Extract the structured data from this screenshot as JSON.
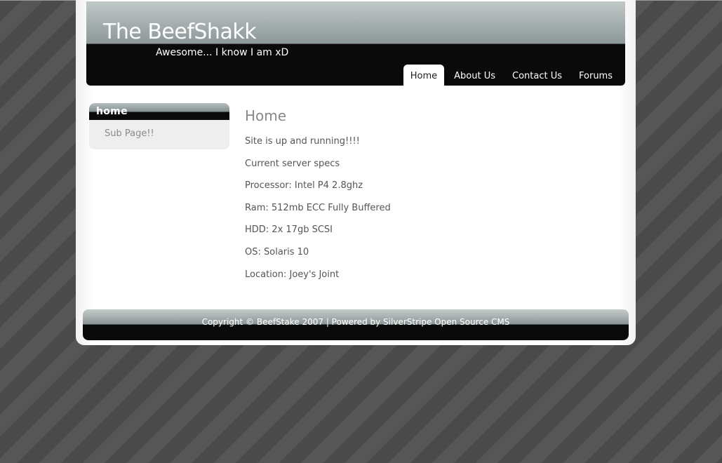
{
  "header": {
    "title": "The BeefShakk",
    "tagline": "Awesome... I know I am xD"
  },
  "nav": {
    "items": [
      {
        "label": "Home",
        "active": true
      },
      {
        "label": "About Us",
        "active": false
      },
      {
        "label": "Contact Us",
        "active": false
      },
      {
        "label": "Forums",
        "active": false
      }
    ]
  },
  "sidebar": {
    "heading": "home",
    "items": [
      {
        "label": "Sub Page!!"
      }
    ]
  },
  "content": {
    "title": "Home",
    "paragraphs": [
      "Site is up and running!!!!",
      "Current server specs",
      "Processor: Intel P4 2.8ghz",
      "Ram: 512mb ECC Fully Buffered",
      "HDD: 2x 17gb SCSI",
      "OS: Solaris 10",
      "Location: Joey's Joint"
    ]
  },
  "footer": {
    "copyright": "Copyright © BeefStake 2007 | Powered by ",
    "link": "SilverStripe Open Source CMS"
  }
}
